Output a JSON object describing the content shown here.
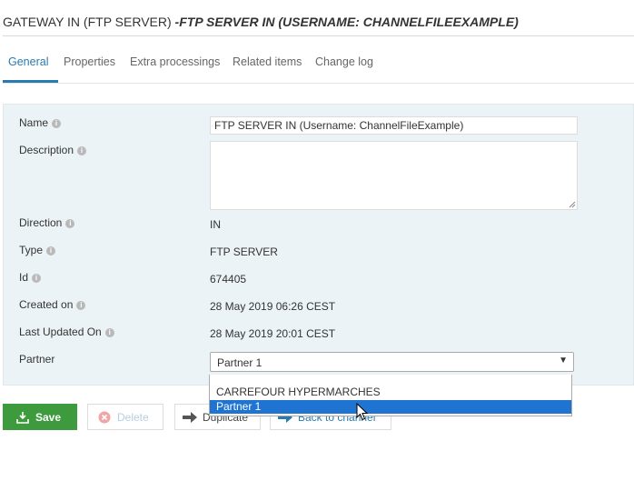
{
  "header": {
    "title_main": "GATEWAY IN (FTP SERVER) ",
    "title_sub": "-FTP SERVER IN (USERNAME: CHANNELFILEEXAMPLE)"
  },
  "tabs": [
    {
      "label": "General",
      "active": true
    },
    {
      "label": "Properties"
    },
    {
      "label": "Extra processings"
    },
    {
      "label": "Related items"
    },
    {
      "label": "Change log"
    }
  ],
  "form": {
    "name_label": "Name",
    "name_value": "FTP SERVER IN (Username: ChannelFileExample)",
    "description_label": "Description",
    "description_value": "",
    "direction_label": "Direction",
    "direction_value": "IN",
    "type_label": "Type",
    "type_value": "FTP SERVER",
    "id_label": "Id",
    "id_value": "674405",
    "created_label": "Created on",
    "created_value": "28 May 2019 06:26 CEST",
    "updated_label": "Last Updated On",
    "updated_value": "28 May 2019 20:01 CEST",
    "partner_label": "Partner",
    "partner_value": "Partner 1",
    "partner_options": [
      "CARREFOUR HYPERMARCHES",
      "Partner 1"
    ],
    "info_glyph": "i"
  },
  "actions": {
    "save": "Save",
    "delete": "Delete",
    "duplicate": "Duplicate",
    "back": "Back to channel"
  },
  "colors": {
    "accent": "#2a7ab0",
    "save_green": "#3d9a3d",
    "panel_bg": "#ecf3f6",
    "highlight": "#1e74d0"
  }
}
